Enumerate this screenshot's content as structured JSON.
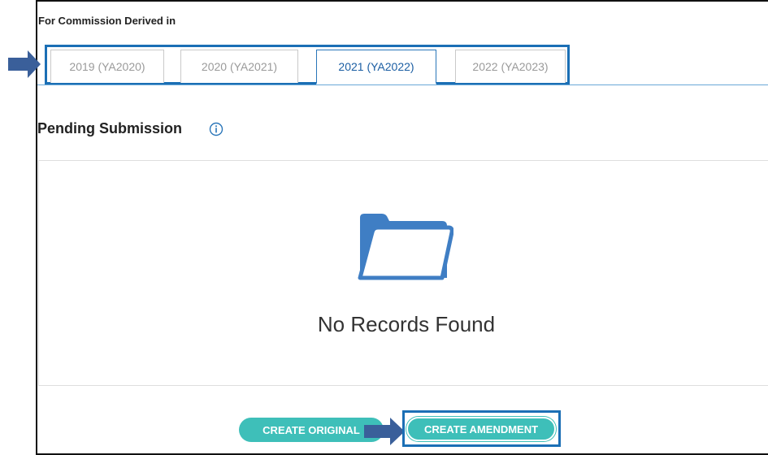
{
  "section_label": "For Commission Derived in",
  "tabs": [
    {
      "label": "2019 (YA2020)",
      "active": false
    },
    {
      "label": "2020 (YA2021)",
      "active": false
    },
    {
      "label": "2021 (YA2022)",
      "active": true
    },
    {
      "label": "2022 (YA2023)",
      "active": false
    }
  ],
  "pending": {
    "title": "Pending Submission",
    "info_icon": "info-circle-icon"
  },
  "empty_state": {
    "icon": "folder-icon",
    "message": "No Records Found"
  },
  "actions": {
    "create_original": "CREATE ORIGINAL",
    "create_amendment": "CREATE AMENDMENT"
  },
  "colors": {
    "accent": "#3ebfb9",
    "highlight": "#1b6fb5",
    "arrow": "#3a5f9a",
    "folder": "#5b95cf"
  }
}
